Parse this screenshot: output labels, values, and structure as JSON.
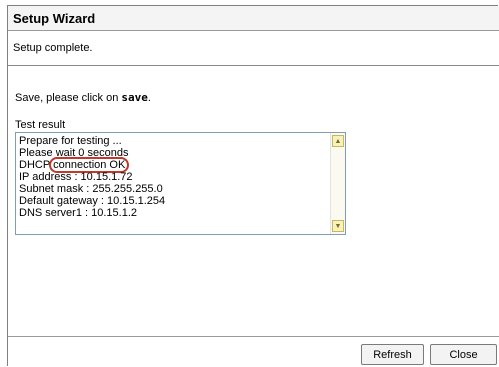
{
  "window": {
    "title": "Setup Wizard",
    "subtitle": "Setup complete."
  },
  "instruction": {
    "prefix": "Save, please click on ",
    "action": "save",
    "suffix": "."
  },
  "test_result": {
    "label": "Test result",
    "lines": [
      "Prepare for testing ...",
      "Please wait 0 seconds",
      "DHCP",
      "IP address : 10.15.1.72",
      "Subnet mask : 255.255.255.0",
      "Default gateway  : 10.15.1.254",
      "DNS server1 : 10.15.1.2"
    ],
    "highlight_text": "connection OK",
    "highlight_color": "#c0392b"
  },
  "scrollbar": {
    "up_icon": "scroll-up-arrow",
    "down_icon": "scroll-down-arrow"
  },
  "buttons": {
    "refresh": "Refresh",
    "close": "Close"
  }
}
